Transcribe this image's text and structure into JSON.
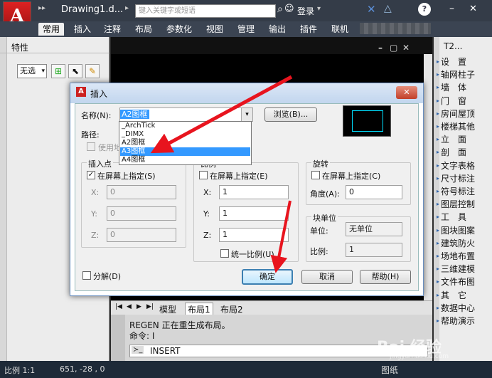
{
  "window": {
    "title": "Drawing1.d...",
    "search_placeholder": "键入关键字或短语",
    "login": "登录",
    "help": "?",
    "minimize": "–",
    "close": "✕",
    "qat_arrow": "▸▸"
  },
  "ribbon": {
    "tabs": [
      "常用",
      "插入",
      "注释",
      "布局",
      "参数化",
      "视图",
      "管理",
      "输出",
      "插件",
      "联机"
    ]
  },
  "left_panel": {
    "title": "特性",
    "dropdown_value": "无选",
    "dropdown_arrow": "▾"
  },
  "drawing": {
    "ctrl_min": "–",
    "ctrl_restore": "▢",
    "ctrl_close": "✕",
    "tabs": [
      "模型",
      "布局1",
      "布局2"
    ],
    "nav_arrows": [
      "|◀",
      "◀",
      "▶",
      "▶|"
    ]
  },
  "right_panel": {
    "title": "T2...",
    "items": [
      "设　置",
      "轴网柱子",
      "墙　体",
      "门　窗",
      "房间屋顶",
      "楼梯其他",
      "立　面",
      "剖　面",
      "文字表格",
      "尺寸标注",
      "符号标注",
      "图层控制",
      "工　具",
      "图块图案",
      "建筑防火",
      "场地布置",
      "三维建模",
      "文件布图",
      "其　它",
      "数据中心",
      "帮助演示"
    ]
  },
  "command": {
    "line1": "REGEN 正在重生成布局。",
    "line2": "命令: I",
    "prompt_icon": "≻_",
    "input": "INSERT"
  },
  "status": {
    "scale": "比例 1:1",
    "coords": "651, -28 , 0",
    "layout_btn": "图纸"
  },
  "dialog": {
    "title": "插入",
    "close": "✕",
    "name_label": "名称(N):",
    "name_value": "A2图框",
    "browse": "浏览(B)...",
    "path_label": "路径:",
    "use_geo": "使用地",
    "dropdown_items": [
      "_ArchTick",
      "_DIMX",
      "A2图框",
      "A3图框",
      "A4图框"
    ],
    "insert_group": "插入点",
    "insert_onscreen": "在屏幕上指定(S)",
    "scale_group": "比例",
    "scale_onscreen": "在屏幕上指定(E)",
    "rot_group": "旋转",
    "rot_onscreen": "在屏幕上指定(C)",
    "x_label": "X:",
    "y_label": "Y:",
    "z_label": "Z:",
    "ins_x": "0",
    "ins_y": "0",
    "ins_z": "0",
    "sc_x": "1",
    "sc_y": "1",
    "sc_z": "1",
    "uniform": "统一比例(U)",
    "angle_label": "角度(A):",
    "angle_value": "0",
    "unit_group": "块单位",
    "unit_label": "单位:",
    "unit_value": "无单位",
    "factor_label": "比例:",
    "factor_value": "1",
    "explode": "分解(D)",
    "ok": "确定",
    "cancel": "取消",
    "help": "帮助(H)",
    "check_mark": "✓",
    "combo_arrow": "▾"
  },
  "watermark": {
    "text": "Bai 经验",
    "sub": "jingyan.baidu.com"
  }
}
